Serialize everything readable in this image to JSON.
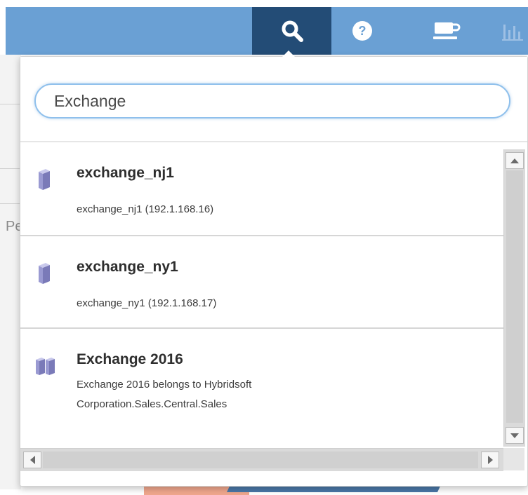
{
  "colors": {
    "topbar": "#6aa0d4",
    "active_tab": "#234c76",
    "search_focus": "#8fc0ec"
  },
  "background": {
    "partial_text": "Pe"
  },
  "toolbar": {
    "buttons": [
      {
        "icon": "search-icon",
        "active": true
      },
      {
        "icon": "help-icon",
        "active": false
      },
      {
        "icon": "coffee-cup-icon",
        "active": false
      },
      {
        "icon": "bar-chart-icon",
        "active": false
      }
    ]
  },
  "search": {
    "value": "Exchange"
  },
  "results": [
    {
      "title": "exchange_nj1",
      "subtitle": "exchange_nj1 (192.1.168.16)",
      "icon": "server-icon"
    },
    {
      "title": "exchange_ny1",
      "subtitle": "exchange_ny1 (192.1.168.17)",
      "icon": "server-icon"
    },
    {
      "title": "Exchange 2016",
      "subtitle_line1": "Exchange 2016 belongs to Hybridsoft",
      "subtitle_line2": "Corporation.Sales.Central.Sales",
      "icon": "server-group-icon"
    }
  ]
}
